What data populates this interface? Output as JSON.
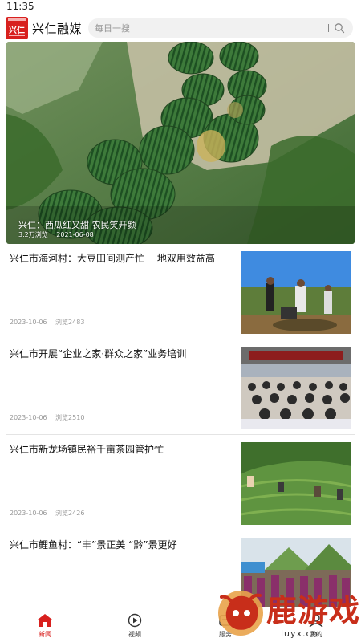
{
  "status": {
    "time": "11:35"
  },
  "header": {
    "logo_text": "兴仁",
    "app_title": "兴仁融媒",
    "search_placeholder": "每日一搜"
  },
  "banner": {
    "title": "兴仁：西瓜红又甜 农民笑开颜",
    "views": "3.2万浏览",
    "date": "2021-06-08"
  },
  "news": [
    {
      "title": "兴仁市海河村：大豆田间测产忙 一地双用效益高",
      "date": "2023-10-06",
      "views": "浏览2483"
    },
    {
      "title": "兴仁市开展“企业之家·群众之家”业务培训",
      "date": "2023-10-06",
      "views": "浏览2510"
    },
    {
      "title": "兴仁市新龙场镇民裕千亩茶园管护忙",
      "date": "2023-10-06",
      "views": "浏览2426"
    },
    {
      "title": "兴仁市鲤鱼村：“丰”景正美 “黔”景更好",
      "date": "",
      "views": ""
    }
  ],
  "nav": [
    {
      "label": "新闻",
      "icon": "home-icon",
      "active": true
    },
    {
      "label": "视频",
      "icon": "play-icon",
      "active": false
    },
    {
      "label": "服务",
      "icon": "service-icon",
      "active": false
    },
    {
      "label": "我的",
      "icon": "user-icon",
      "active": false
    }
  ],
  "watermark": {
    "text": "鹿游戏",
    "url": "luyx.cn"
  },
  "colors": {
    "accent": "#d8201e",
    "muted": "#999999"
  }
}
